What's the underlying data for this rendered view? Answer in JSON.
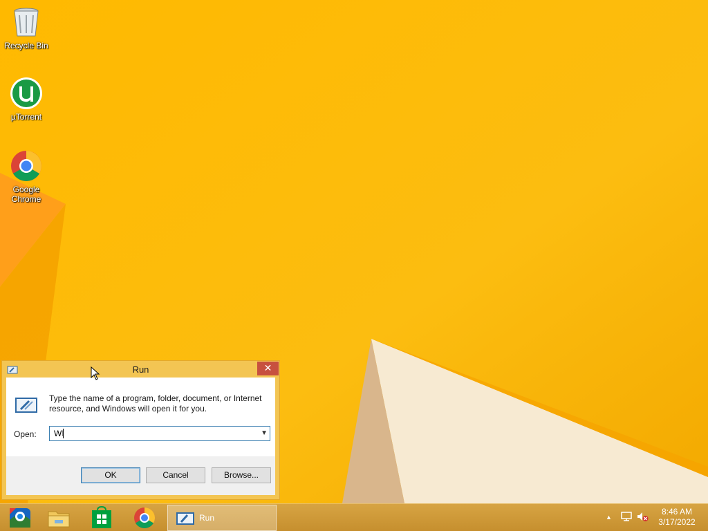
{
  "desktop": {
    "icons": [
      {
        "label": "Recycle Bin",
        "icon": "recycle-bin-icon"
      },
      {
        "label": "µTorrent",
        "icon": "utorrent-icon"
      },
      {
        "label_line1": "Google",
        "label_line2": "Chrome",
        "icon": "chrome-icon"
      }
    ]
  },
  "run_dialog": {
    "title": "Run",
    "close": "✕",
    "description": "Type the name of a program, folder, document, or Internet resource, and Windows will open it for you.",
    "open_label": "Open:",
    "open_value": "WI",
    "buttons": {
      "ok": "OK",
      "cancel": "Cancel",
      "browse": "Browse..."
    }
  },
  "taskbar": {
    "pinned": [
      "media-center-icon",
      "file-explorer-icon",
      "store-icon",
      "chrome-icon"
    ],
    "active_window": {
      "label": "Run",
      "icon": "run-icon"
    },
    "tray": {
      "show_hidden": "▲",
      "network": "network-icon",
      "volume": "volume-muted-icon"
    },
    "clock": {
      "time": "8:46 AM",
      "date": "3/17/2022"
    }
  },
  "colors": {
    "accent": "#f6b200",
    "taskbar": "#cf9a38",
    "close_button": "#c7503f"
  }
}
